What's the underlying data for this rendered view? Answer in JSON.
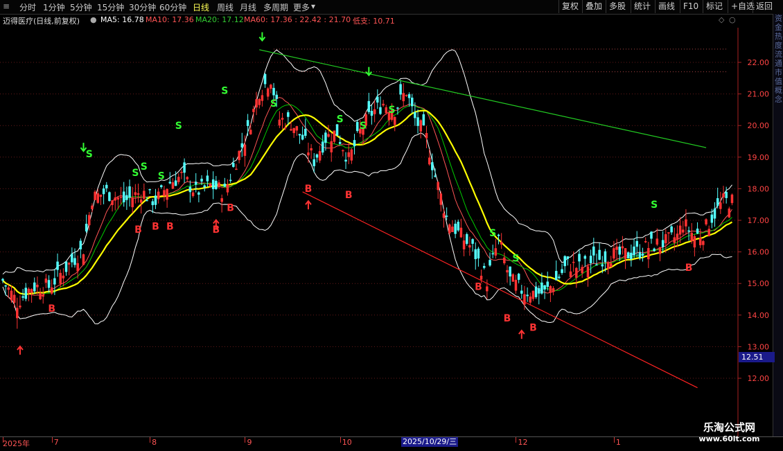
{
  "toolbar": {
    "periods": [
      "分时",
      "1分钟",
      "5分钟",
      "15分钟",
      "30分钟",
      "60分钟",
      "日线",
      "周线",
      "月线",
      "多周期",
      "更多"
    ],
    "active_period": "日线",
    "more_arrow": "▾",
    "right_buttons": [
      "复权",
      "叠加",
      "多股",
      "统计",
      "画线",
      "F10",
      "标记",
      "+自选",
      "返回"
    ]
  },
  "info": {
    "title": "迈得医疗(日线,前复权)",
    "ma5": "MA5: 16.78",
    "ma10": "MA10: 17.36",
    "ma20": "MA20: 17.12",
    "ma60": "MA60: 17.36 : 22.42 : 21.70",
    "low_support": "低支: 10.71"
  },
  "colors": {
    "up": "#ff3333",
    "down": "#54ffff",
    "ma_yellow": "#ffff00",
    "ma_white": "#ffffff",
    "ma_green": "#00cc00",
    "ma_red": "#ff5555",
    "trend_green": "#22cc22",
    "trend_red": "#ff2222",
    "signal_b": "#ff3333",
    "signal_s": "#33ff33"
  },
  "chart_data": {
    "type": "candlestick",
    "y_ticks": [
      "22.00",
      "21.00",
      "20.00",
      "19.00",
      "18.00",
      "17.00",
      "16.00",
      "15.00",
      "14.00",
      "13.00",
      "12.00"
    ],
    "y_tick_values": [
      22,
      21,
      20,
      19,
      18,
      17,
      16,
      15,
      14,
      13,
      12
    ],
    "ylim": [
      11.3,
      23.4
    ],
    "date_labels": [
      {
        "text": "2025年",
        "index": 0
      },
      {
        "text": "7",
        "index": 17
      },
      {
        "text": "8",
        "index": 51
      },
      {
        "text": "9",
        "index": 84
      },
      {
        "text": "10",
        "index": 117
      },
      {
        "text": "2025/10/29/三",
        "index": 142
      },
      {
        "text": "12",
        "index": 178
      },
      {
        "text": "1",
        "index": 212
      }
    ],
    "current_price": "12.51",
    "keypoints": [
      [
        0,
        15.1
      ],
      [
        5,
        14.4
      ],
      [
        10,
        14.9
      ],
      [
        16,
        14.9
      ],
      [
        22,
        15.5
      ],
      [
        28,
        16.1
      ],
      [
        31,
        17.7
      ],
      [
        36,
        17.9
      ],
      [
        42,
        17.6
      ],
      [
        48,
        17.9
      ],
      [
        53,
        17.6
      ],
      [
        58,
        18.2
      ],
      [
        62,
        18.4
      ],
      [
        67,
        17.9
      ],
      [
        72,
        18.1
      ],
      [
        77,
        17.9
      ],
      [
        81,
        18.9
      ],
      [
        85,
        19.8
      ],
      [
        89,
        21.1
      ],
      [
        93,
        21.5
      ],
      [
        96,
        20.2
      ],
      [
        100,
        20.1
      ],
      [
        104,
        19.6
      ],
      [
        108,
        18.9
      ],
      [
        112,
        19.6
      ],
      [
        116,
        19.8
      ],
      [
        120,
        18.9
      ],
      [
        124,
        19.8
      ],
      [
        128,
        20.4
      ],
      [
        132,
        20.7
      ],
      [
        136,
        20.5
      ],
      [
        140,
        21.1
      ],
      [
        143,
        20.2
      ],
      [
        147,
        19.6
      ],
      [
        150,
        18.4
      ],
      [
        154,
        17.1
      ],
      [
        158,
        16.6
      ],
      [
        163,
        16.1
      ],
      [
        168,
        15.1
      ],
      [
        172,
        16.4
      ],
      [
        176,
        15.1
      ],
      [
        180,
        14.8
      ],
      [
        184,
        14.7
      ],
      [
        188,
        14.7
      ],
      [
        192,
        15.1
      ],
      [
        196,
        15.6
      ],
      [
        200,
        15.5
      ],
      [
        205,
        15.7
      ],
      [
        210,
        15.9
      ],
      [
        215,
        15.9
      ],
      [
        220,
        16.0
      ],
      [
        225,
        16.2
      ],
      [
        230,
        16.3
      ],
      [
        234,
        16.5
      ],
      [
        236,
        16.9
      ],
      [
        240,
        16.5
      ],
      [
        243,
        16.6
      ],
      [
        246,
        17.1
      ],
      [
        250,
        17.6
      ],
      [
        253,
        17.6
      ]
    ],
    "signals": [
      {
        "type": "B",
        "index": 17,
        "price": 14.1
      },
      {
        "type": "up_arrow",
        "index": 6,
        "price": 12.9
      },
      {
        "type": "S",
        "index": 30,
        "price": 19.0
      },
      {
        "type": "down_arrow",
        "index": 28,
        "price": 19.3
      },
      {
        "type": "S",
        "index": 46,
        "price": 18.4
      },
      {
        "type": "S",
        "index": 49,
        "price": 18.6
      },
      {
        "type": "B",
        "index": 47,
        "price": 16.6
      },
      {
        "type": "B",
        "index": 53,
        "price": 16.7
      },
      {
        "type": "S",
        "index": 55,
        "price": 18.3
      },
      {
        "type": "B",
        "index": 58,
        "price": 16.7
      },
      {
        "type": "S",
        "index": 61,
        "price": 19.9
      },
      {
        "type": "up_arrow",
        "index": 74,
        "price": 16.9
      },
      {
        "type": "B",
        "index": 74,
        "price": 16.6
      },
      {
        "type": "B",
        "index": 79,
        "price": 17.3
      },
      {
        "type": "S",
        "index": 77,
        "price": 21.0
      },
      {
        "type": "down_arrow",
        "index": 90,
        "price": 22.8
      },
      {
        "type": "S",
        "index": 94,
        "price": 20.6
      },
      {
        "type": "up_arrow",
        "index": 106,
        "price": 17.5
      },
      {
        "type": "B",
        "index": 106,
        "price": 17.9
      },
      {
        "type": "S",
        "index": 117,
        "price": 20.1
      },
      {
        "type": "B",
        "index": 120,
        "price": 17.7
      },
      {
        "type": "down_arrow",
        "index": 127,
        "price": 21.7
      },
      {
        "type": "S",
        "index": 125,
        "price": 19.9
      },
      {
        "type": "S",
        "index": 135,
        "price": 20.4
      },
      {
        "type": "B",
        "index": 165,
        "price": 14.8
      },
      {
        "type": "S",
        "index": 170,
        "price": 16.5
      },
      {
        "type": "S",
        "index": 178,
        "price": 15.7
      },
      {
        "type": "B",
        "index": 175,
        "price": 13.8
      },
      {
        "type": "up_arrow",
        "index": 180,
        "price": 13.4
      },
      {
        "type": "B",
        "index": 184,
        "price": 13.5
      },
      {
        "type": "S",
        "index": 226,
        "price": 17.4
      },
      {
        "type": "B",
        "index": 238,
        "price": 15.4
      }
    ],
    "trend_lines": [
      {
        "name": "resistance",
        "from": [
          89,
          22.4
        ],
        "to": [
          244,
          19.3
        ],
        "color": "green"
      },
      {
        "name": "support",
        "from": [
          104,
          17.9
        ],
        "to": [
          241,
          11.7
        ],
        "color": "red"
      }
    ],
    "dotted_levels": [
      22.42,
      21.7
    ]
  },
  "right_panel_text": "资金热度流通市值概念",
  "watermark": {
    "line1": "乐淘公式网",
    "line2": "www.60lt.com"
  }
}
